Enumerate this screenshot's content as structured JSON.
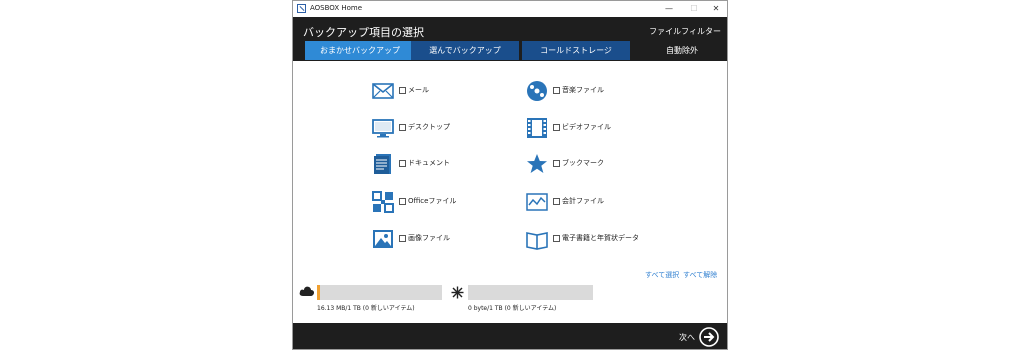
{
  "window": {
    "title": "AOSBOX Home",
    "min": "—",
    "max": "☐",
    "close": "✕"
  },
  "header": {
    "title": "バックアップ項目の選択",
    "filter": "ファイルフィルター"
  },
  "tabs": [
    {
      "label": "おまかせバックアップ",
      "active": true
    },
    {
      "label": "選んでバックアップ",
      "active": false
    },
    {
      "label": "コールドストレージ",
      "active": false
    },
    {
      "label": "自動除外",
      "active": false
    }
  ],
  "items": [
    {
      "label": "メール",
      "icon": "mail-icon",
      "checked": false
    },
    {
      "label": "デスクトップ",
      "icon": "monitor-icon",
      "checked": false
    },
    {
      "label": "ドキュメント",
      "icon": "document-icon",
      "checked": false
    },
    {
      "label": "Officeファイル",
      "icon": "office-icon",
      "checked": false
    },
    {
      "label": "画像ファイル",
      "icon": "image-icon",
      "checked": false
    },
    {
      "label": "音楽ファイル",
      "icon": "music-icon",
      "checked": false
    },
    {
      "label": "ビデオファイル",
      "icon": "video-icon",
      "checked": false
    },
    {
      "label": "ブックマーク",
      "icon": "star-icon",
      "checked": false
    },
    {
      "label": "会計ファイル",
      "icon": "chart-icon",
      "checked": false
    },
    {
      "label": "電子書籍と年賀状データ",
      "icon": "book-icon",
      "checked": false
    }
  ],
  "selection": {
    "select_all": "すべて選択",
    "deselect_all": "すべて解除"
  },
  "storage": {
    "cloud_text": "16.13 MB/1 TB (0 新しいアイテム)",
    "cloud_fill": 0.02,
    "cold_text": "0 byte/1 TB (0 新しいアイテム)",
    "cold_fill": 0
  },
  "footer": {
    "next": "次へ"
  },
  "colors": {
    "accent": "#2f8ad6",
    "icon_blue": "#2a74b8",
    "header_bg": "#1e1e1e",
    "progress": "#f0a030"
  }
}
